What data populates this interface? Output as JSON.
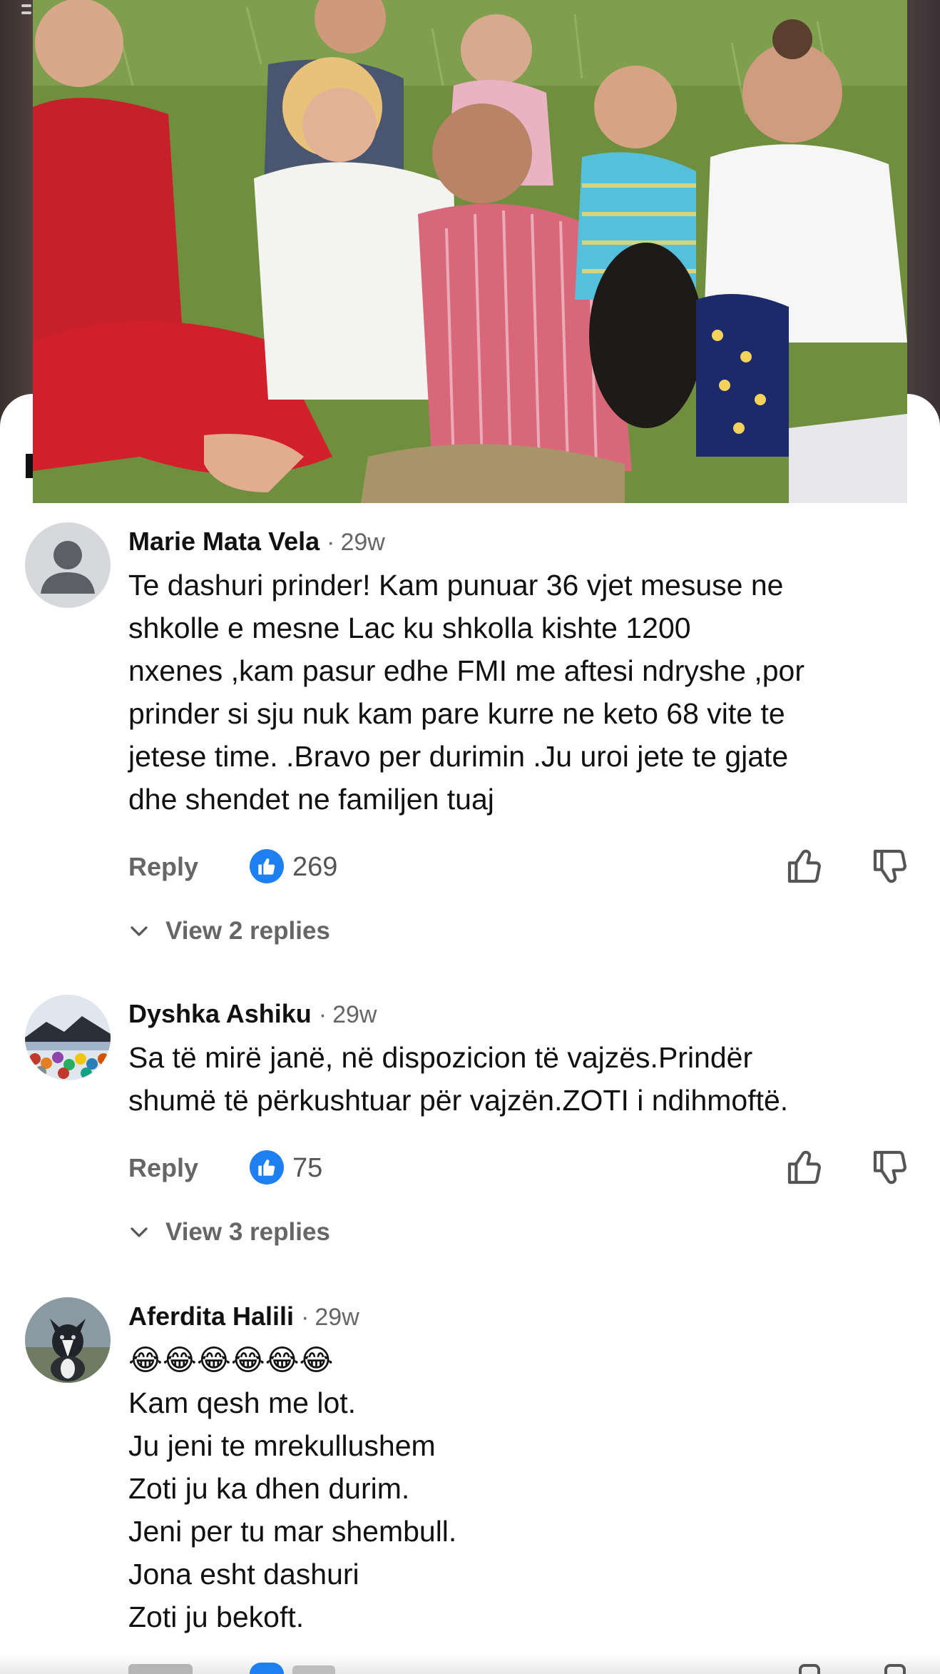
{
  "comments": [
    {
      "author": "Marie Mata Vela",
      "time": "29w",
      "avatar": "default-person-icon",
      "lines": [
        "Te dashuri prinder! Kam punuar 36 vjet mesuse ne",
        "shkolle e mesne Lac ku shkolla kishte 1200",
        "nxenes ,kam pasur edhe FMI me aftesi ndryshe ,por",
        "prinder si sju nuk kam pare kurre ne keto 68 vite te",
        "jetese time.  .Bravo per durimin .Ju uroi jete te gjate",
        "dhe shendet ne familjen tuaj"
      ],
      "reply_label": "Reply",
      "likes": "269",
      "view_replies": "View 2 replies"
    },
    {
      "author": "Dyshka Ashiku",
      "time": "29w",
      "avatar": "landscape-photo",
      "lines": [
        "Sa të mirë janë, në dispozicion të vajzës.Prindër",
        "shumë të përkushtuar për vajzën.ZOTI i ndihmoftë."
      ],
      "reply_label": "Reply",
      "likes": "75",
      "view_replies": "View 3 replies"
    },
    {
      "author": "Aferdita Halili",
      "time": "29w",
      "avatar": "dog-photo",
      "lines": [
        "😂😂😂😂😂😂",
        "Kam qesh me lot.",
        "Ju jeni te mrekullushem",
        "Zoti ju ka dhen durim.",
        "Jeni per tu mar shembull.",
        "Jona esht dashuri",
        "Zoti ju bekoft."
      ]
    }
  ],
  "separator": "·",
  "colors": {
    "like_blue": "#1d7ff0",
    "meta_gray": "#666666",
    "text": "#111111"
  },
  "icons": {
    "like_badge": "thumbs-up-filled-icon",
    "thumb_up": "thumbs-up-outline-icon",
    "thumb_down": "thumbs-down-outline-icon",
    "chevron": "chevron-down-icon"
  }
}
